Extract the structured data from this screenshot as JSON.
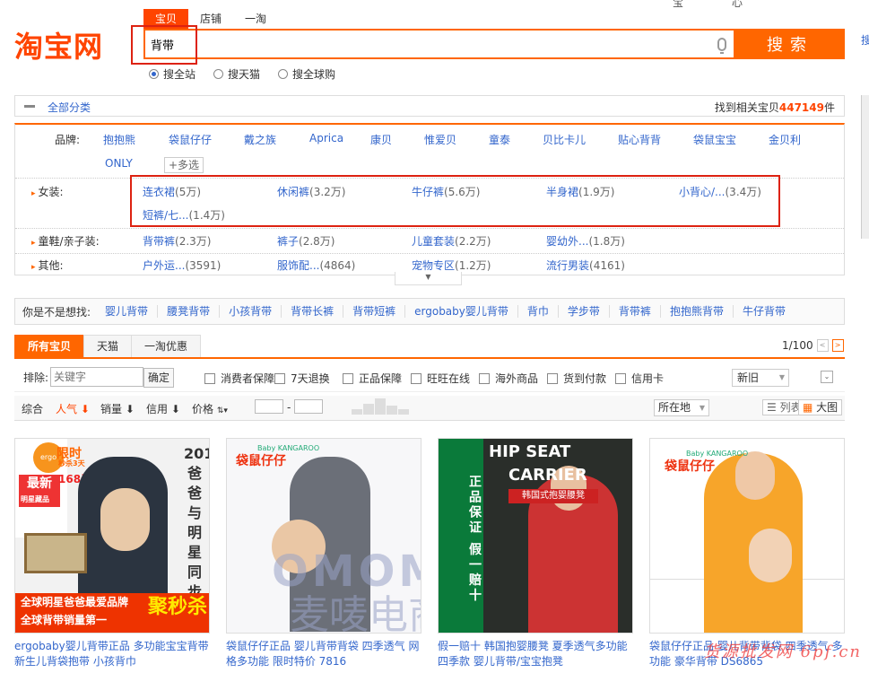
{
  "header": {
    "logo_text": "淘宝网",
    "top_glyphs": [
      "宝",
      "心"
    ],
    "search_tabs": [
      {
        "label": "宝贝",
        "active": true
      },
      {
        "label": "店铺",
        "active": false
      },
      {
        "label": "一淘",
        "active": false
      }
    ],
    "search_value": "背带",
    "search_button": "搜索",
    "right_edge_glyph": "搜",
    "scope_options": [
      {
        "label": "搜全站",
        "selected": true
      },
      {
        "label": "搜天猫",
        "selected": false
      },
      {
        "label": "搜全球购",
        "selected": false
      }
    ]
  },
  "category_bar": {
    "all_label": "全部分类",
    "found_prefix": "找到相关宝贝",
    "found_count": "447149",
    "found_suffix": "件"
  },
  "filters": {
    "brand_label": "品牌:",
    "brands": [
      "抱抱熊",
      "袋鼠仔仔",
      "戴之族",
      "Aprica",
      "康贝",
      "惟爱贝",
      "童泰",
      "贝比卡儿",
      "贴心背背",
      "袋鼠宝宝",
      "金贝利",
      "ONLY"
    ],
    "more_select": "+多选",
    "rows": [
      {
        "label": "女装:",
        "items": [
          {
            "name": "连衣裙",
            "count": "(5万)"
          },
          {
            "name": "休闲裤",
            "count": "(3.2万)"
          },
          {
            "name": "牛仔裤",
            "count": "(5.6万)"
          },
          {
            "name": "半身裙",
            "count": "(1.9万)"
          },
          {
            "name": "小背心/...",
            "count": "(3.4万)"
          },
          {
            "name": "短裤/七...",
            "count": "(1.4万)"
          }
        ]
      },
      {
        "label": "童鞋/亲子装:",
        "items": [
          {
            "name": "背带裤",
            "count": "(2.3万)"
          },
          {
            "name": "裤子",
            "count": "(2.8万)"
          },
          {
            "name": "儿童套装",
            "count": "(2.2万)"
          },
          {
            "name": "婴幼外...",
            "count": "(1.8万)"
          }
        ]
      },
      {
        "label": "其他:",
        "items": [
          {
            "name": "户外运...",
            "count": "(3591)"
          },
          {
            "name": "服饰配...",
            "count": "(4864)"
          },
          {
            "name": "宠物专区",
            "count": "(1.2万)"
          },
          {
            "name": "流行男装",
            "count": "(4161)"
          }
        ]
      }
    ],
    "expand_icon": "▼"
  },
  "suggest": {
    "label": "你是不是想找:",
    "items": [
      "婴儿背带",
      "腰凳背带",
      "小孩背带",
      "背带长裤",
      "背带短裤",
      "ergobaby婴儿背带",
      "背巾",
      "学步带",
      "背带裤",
      "抱抱熊背带",
      "牛仔背带"
    ]
  },
  "result_tabs": [
    {
      "label": "所有宝贝",
      "active": true
    },
    {
      "label": "天猫",
      "active": false
    },
    {
      "label": "一淘优惠",
      "active": false
    }
  ],
  "pager": {
    "text": "1/100",
    "prev": "<",
    "next": ">"
  },
  "filter_bar": {
    "exclude_label": "排除:",
    "exclude_placeholder": "关键字",
    "confirm": "确定",
    "checkboxes": [
      "消费者保障",
      "7天退换",
      "正品保障",
      "旺旺在线",
      "海外商品",
      "货到付款",
      "信用卡"
    ],
    "condition_select": "新旧"
  },
  "sort_bar": {
    "items": [
      {
        "label": "综合",
        "active": false
      },
      {
        "label": "人气",
        "active": true
      },
      {
        "label": "销量",
        "active": false
      },
      {
        "label": "信用",
        "active": false
      },
      {
        "label": "价格",
        "active": false
      }
    ],
    "price_dash": "-",
    "location": "所在地",
    "view_list": "列表",
    "view_big": "大图"
  },
  "products": [
    {
      "title": "ergobaby婴儿背带正品 多功能宝宝背带 新生儿背袋抱带 小孩背巾",
      "image_text": {
        "limited": "限时",
        "sub": "秒杀3天",
        "price": "168元",
        "latest": "最新",
        "latest2": "明星藏品",
        "vertical": "2013爸爸与明星同步",
        "slogan1": "全球明星爸爸最爱品牌",
        "slogan2": "全球背带销量第一",
        "flash": "聚秒杀"
      }
    },
    {
      "title": "袋鼠仔仔正品 婴儿背带背袋 四季透气 网格多功能 限时特价 7816",
      "image_text": {
        "brand": "袋鼠仔仔",
        "brand_sub": "Baby KANGAROO",
        "wm1": "OMOMAK",
        "wm2": "麦唛电商"
      }
    },
    {
      "title": "假一赔十 韩国抱婴腰凳 夏季透气多功能 四季款 婴儿背带/宝宝抱凳",
      "image_text": {
        "side": "正品保证 假一赔十",
        "hip": "HIP SEAT",
        "carrier": "CARRIER",
        "banner": "韩国式抱婴腰凳"
      }
    },
    {
      "title": "袋鼠仔仔正品 婴儿背带背袋 四季透气 多功能 豪华背带 DS6865",
      "image_text": {
        "brand": "袋鼠仔仔",
        "brand_sub": "Baby KANGAROO"
      }
    }
  ],
  "watermark": "货源批发网 6pf.cn",
  "colors": {
    "brand": "#ff4400",
    "accent": "#ff6600",
    "link": "#3366cc",
    "annotation_red": "#dd2211"
  }
}
